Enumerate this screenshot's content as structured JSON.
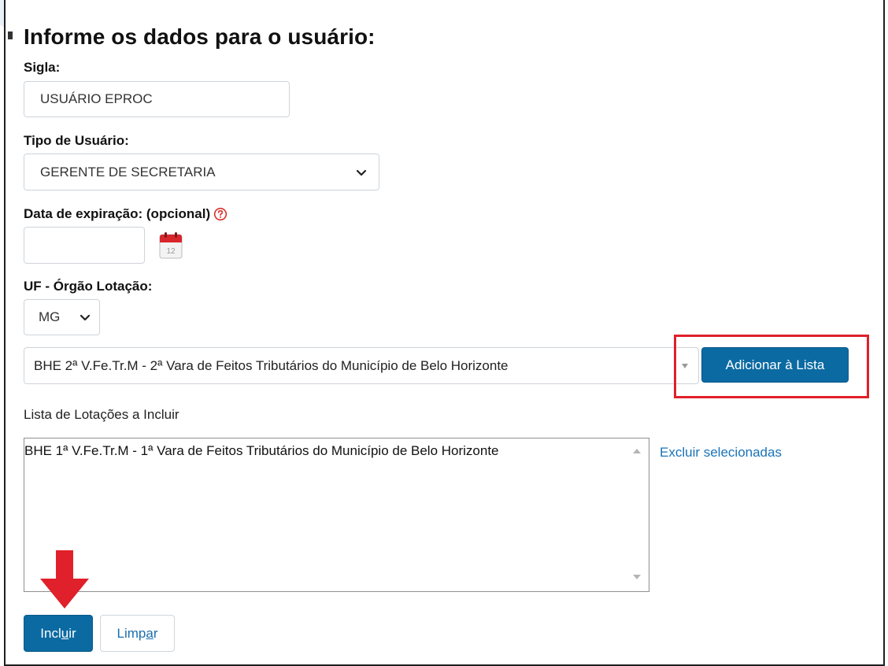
{
  "form": {
    "title": "Informe os dados para o usuário:",
    "sigla_label": "Sigla:",
    "sigla_value": "USUÁRIO EPROC",
    "tipo_label": "Tipo de Usuário:",
    "tipo_value": "GERENTE DE SECRETARIA",
    "data_label": "Data de expiração: (opcional)",
    "data_value": "",
    "calendar_day": "12",
    "uf_label": "UF - Órgão Lotação:",
    "uf_value": "MG",
    "orgao_value": "BHE 2ª V.Fe.Tr.M - 2ª Vara de Feitos Tributários do Município de Belo Horizonte",
    "add_button": "Adicionar à Lista",
    "lista_label": "Lista de Lotações a Incluir",
    "lista_items": [
      "BHE 1ª V.Fe.Tr.M - 1ª Vara de Feitos Tributários do Município de Belo Horizonte"
    ],
    "excluir_link": "Excluir selecionadas",
    "incluir_pre": "Incl",
    "incluir_u": "u",
    "incluir_post": "ir",
    "limpar_pre": "Limp",
    "limpar_u": "a",
    "limpar_post": "r"
  },
  "colors": {
    "primary": "#0b6aa2",
    "link": "#1a73b8",
    "highlight": "#e0202a",
    "help": "#d9302c"
  },
  "icons": {
    "help": "question-circle-icon",
    "calendar": "calendar-icon",
    "chevron": "chevron-down-icon",
    "arrow": "red-arrow-down-icon"
  }
}
